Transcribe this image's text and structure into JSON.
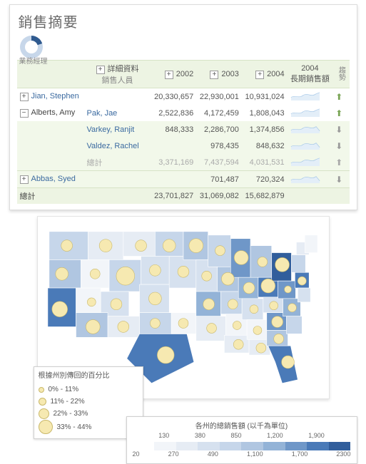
{
  "title": "銷售摘要",
  "subA": "業務經理",
  "headers": {
    "detail": "詳細資料",
    "sales": "銷售人員",
    "y2002": "2002",
    "y2003": "2003",
    "y2004": "2004",
    "period": "2004\n長期銷售額",
    "trend": "趨勢"
  },
  "table": {
    "rows": [
      {
        "exp": "+",
        "mgr": "Jian, Stephen",
        "sp": "",
        "v02": "20,330,657",
        "v03": "22,930,001",
        "v04": "10,931,024",
        "dir": "up"
      },
      {
        "exp": "−",
        "mgr": "Alberts, Amy",
        "sp": "Pak, Jae",
        "v02": "2,522,836",
        "v03": "4,172,459",
        "v04": "1,808,043",
        "dir": "up"
      },
      {
        "exp": "",
        "mgr": "",
        "sp": "Varkey, Ranjit",
        "v02": "848,333",
        "v03": "2,286,700",
        "v04": "1,374,856",
        "dir": "dn"
      },
      {
        "exp": "",
        "mgr": "",
        "sp": "Valdez, Rachel",
        "v02": "",
        "v03": "978,435",
        "v04": "848,632",
        "dir": "dn"
      },
      {
        "exp": "",
        "mgr": "",
        "sp": "總計",
        "v02": "3,371,169",
        "v03": "7,437,594",
        "v04": "4,031,531",
        "dir": "up",
        "muted": true
      },
      {
        "exp": "+",
        "mgr": "Abbas, Syed",
        "sp": "",
        "v02": "",
        "v03": "701,487",
        "v04": "720,324",
        "dir": "dn"
      }
    ],
    "grand": {
      "label": "總計",
      "v02": "23,701,827",
      "v03": "31,069,082",
      "v04": "15,682,879"
    }
  },
  "legend_bub": {
    "title": "根據州別傳回的百分比",
    "items": [
      {
        "s": 6,
        "label": "0% - 11%"
      },
      {
        "s": 9,
        "label": "11% - 22%"
      },
      {
        "s": 13,
        "label": "22% - 33%"
      },
      {
        "s": 18,
        "label": "33% - 44%"
      }
    ]
  },
  "legend_scale": {
    "title": "各州的總銷售額 (以千為單位)",
    "top": [
      "130",
      "380",
      "850",
      "1,200",
      "1,900"
    ],
    "bottom": [
      "20",
      "270",
      "490",
      "1,100",
      "1,700",
      "2300"
    ],
    "colors": [
      "#ffffff",
      "#f2f5f9",
      "#e6ecf4",
      "#d6e1ef",
      "#c6d6ea",
      "#b0c6e1",
      "#93b3d7",
      "#6f97c8",
      "#4a7ab8",
      "#315e9c"
    ]
  },
  "chart_data": {
    "type": "table",
    "title": "銷售摘要",
    "columns": [
      "業務經理",
      "銷售人員",
      "2002",
      "2003",
      "2004"
    ],
    "rows": [
      [
        "Jian, Stephen",
        "",
        20330657,
        22930001,
        10931024
      ],
      [
        "Alberts, Amy",
        "Pak, Jae",
        2522836,
        4172459,
        1808043
      ],
      [
        "Alberts, Amy",
        "Varkey, Ranjit",
        848333,
        2286700,
        1374856
      ],
      [
        "Alberts, Amy",
        "Valdez, Rachel",
        null,
        978435,
        848632
      ],
      [
        "Alberts, Amy",
        "總計",
        3371169,
        7437594,
        4031531
      ],
      [
        "Abbas, Syed",
        "",
        null,
        701487,
        720324
      ],
      [
        "總計",
        "",
        23701827,
        31069082,
        15682879
      ]
    ]
  }
}
